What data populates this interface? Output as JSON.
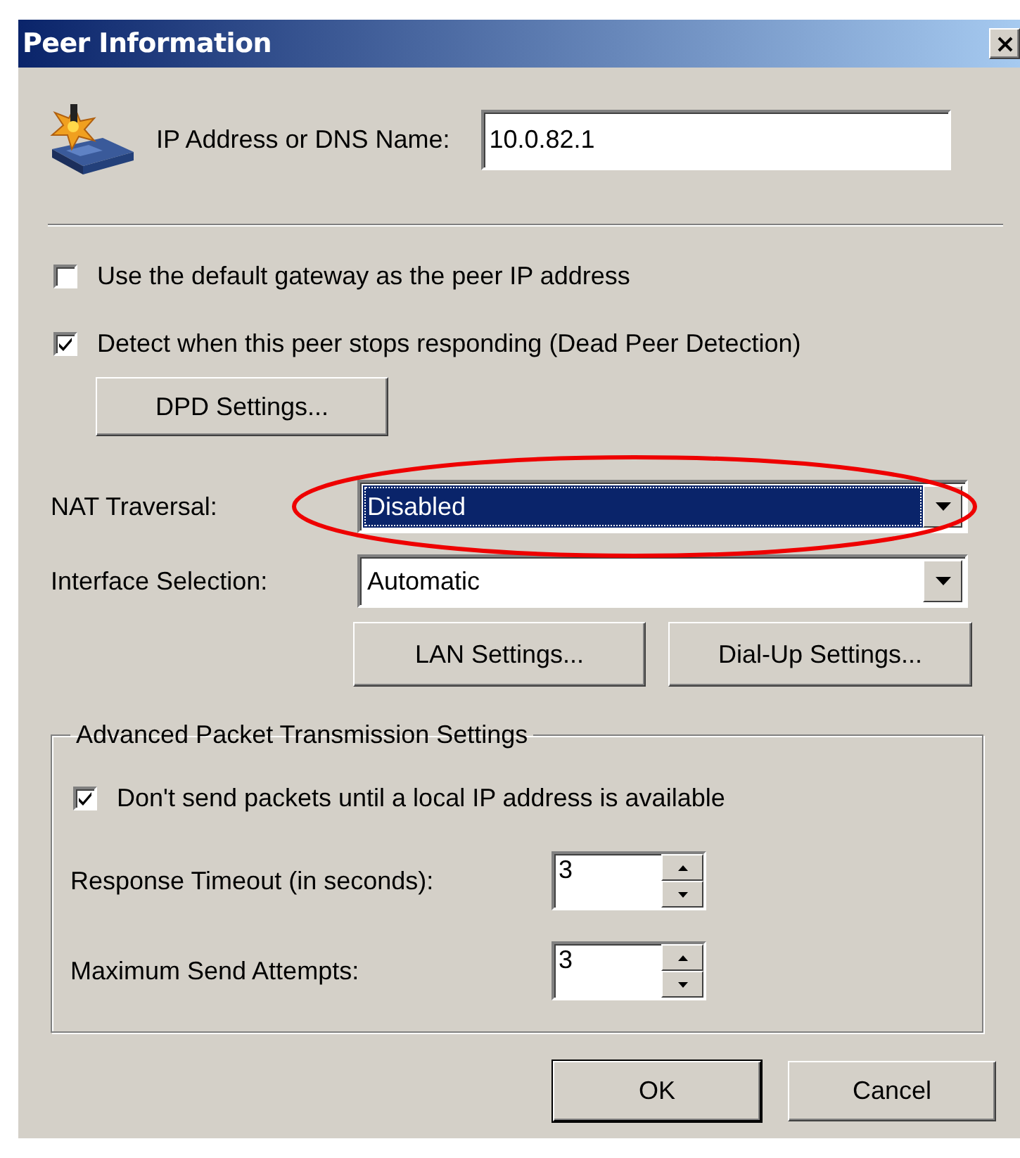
{
  "window": {
    "title": "Peer Information"
  },
  "peer": {
    "label": "IP Address or DNS Name:",
    "value": "10.0.82.1"
  },
  "options": [
    {
      "label": "Use the default gateway as the peer IP address",
      "checked": false
    },
    {
      "label": "Detect when this peer stops responding (Dead Peer Detection)",
      "checked": true
    }
  ],
  "dpd_button": "DPD Settings...",
  "nat_traversal": {
    "label": "NAT Traversal:",
    "value": "Disabled",
    "focused": true,
    "circled": true
  },
  "interface_selection": {
    "label": "Interface Selection:",
    "value": "Automatic",
    "focused": false,
    "circled": false
  },
  "interface_buttons": [
    "LAN Settings...",
    "Dial-Up Settings..."
  ],
  "advanced": {
    "title": "Advanced Packet Transmission Settings",
    "option": {
      "label": "Don't send packets until a local IP address is available",
      "checked": true
    },
    "fields": [
      {
        "label": "Response Timeout (in seconds):",
        "value": "3"
      },
      {
        "label": "Maximum Send Attempts:",
        "value": "3"
      }
    ]
  },
  "buttons": [
    {
      "label": "OK",
      "default": true
    },
    {
      "label": "Cancel",
      "default": false
    }
  ]
}
